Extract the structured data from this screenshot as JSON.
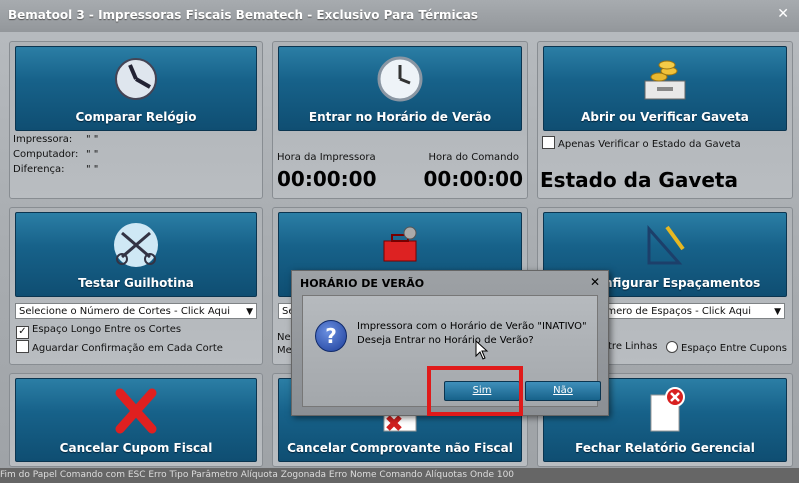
{
  "window": {
    "title": "Bematool 3 - Impressoras Fiscais Bematech - Exclusivo Para Térmicas"
  },
  "tiles": {
    "comparar": "Comparar Relógio",
    "entrar": "Entrar no Horário de Verão",
    "gaveta": "Abrir ou Verificar Gaveta",
    "guilhotina": "Testar Guilhotina",
    "espacamentos": "nfigurar Espaçamentos",
    "cupom": "Cancelar Cupom Fiscal",
    "comprovante": "Cancelar Comprovante não Fiscal",
    "relatorio": "Fechar Relatório Gerencial"
  },
  "clock_panel": {
    "impressora_label": "Impressora:",
    "computador_label": "Computador:",
    "diferenca_label": "Diferença:",
    "quote": "\"      \""
  },
  "verao_panel": {
    "hora_impressora_label": "Hora da Impressora",
    "hora_comando_label": "Hora do Comando",
    "hora_impressora": "00:00:00",
    "hora_comando": "00:00:00"
  },
  "gaveta_panel": {
    "checkbox_label": "Apenas Verificar o Estado da Gaveta",
    "estado": "Estado da Gaveta"
  },
  "guilhotina_panel": {
    "combo": "Selecione o Número de Cortes - Click Aqui",
    "espaco_longo": "Espaço Longo Entre os Cortes",
    "aguardar": "Aguardar Confirmação em Cada Corte"
  },
  "middle_panel": {
    "combo": "Se",
    "line1": "Ne",
    "line2": "Me"
  },
  "espacos_panel": {
    "combo": "úmero de Espaços - Click Aqui",
    "entre_linhas": "tre Linhas",
    "entre_cupons": "Espaço Entre Cupons"
  },
  "dialog": {
    "title": "HORÁRIO DE VERÃO",
    "icon": "question-icon",
    "line1": "Impressora com o Horário de Verão \"INATIVO\"",
    "line2": "Deseja Entrar no Horário de Verão?",
    "sim": "Sim",
    "nao": "Não"
  },
  "bottom_strip": "Fim do Papel        Comando com ESC        Erro Tipo Parâmetro        Alíquota Zogonada        Erro Nome Comando Alíquotas Onde 100"
}
